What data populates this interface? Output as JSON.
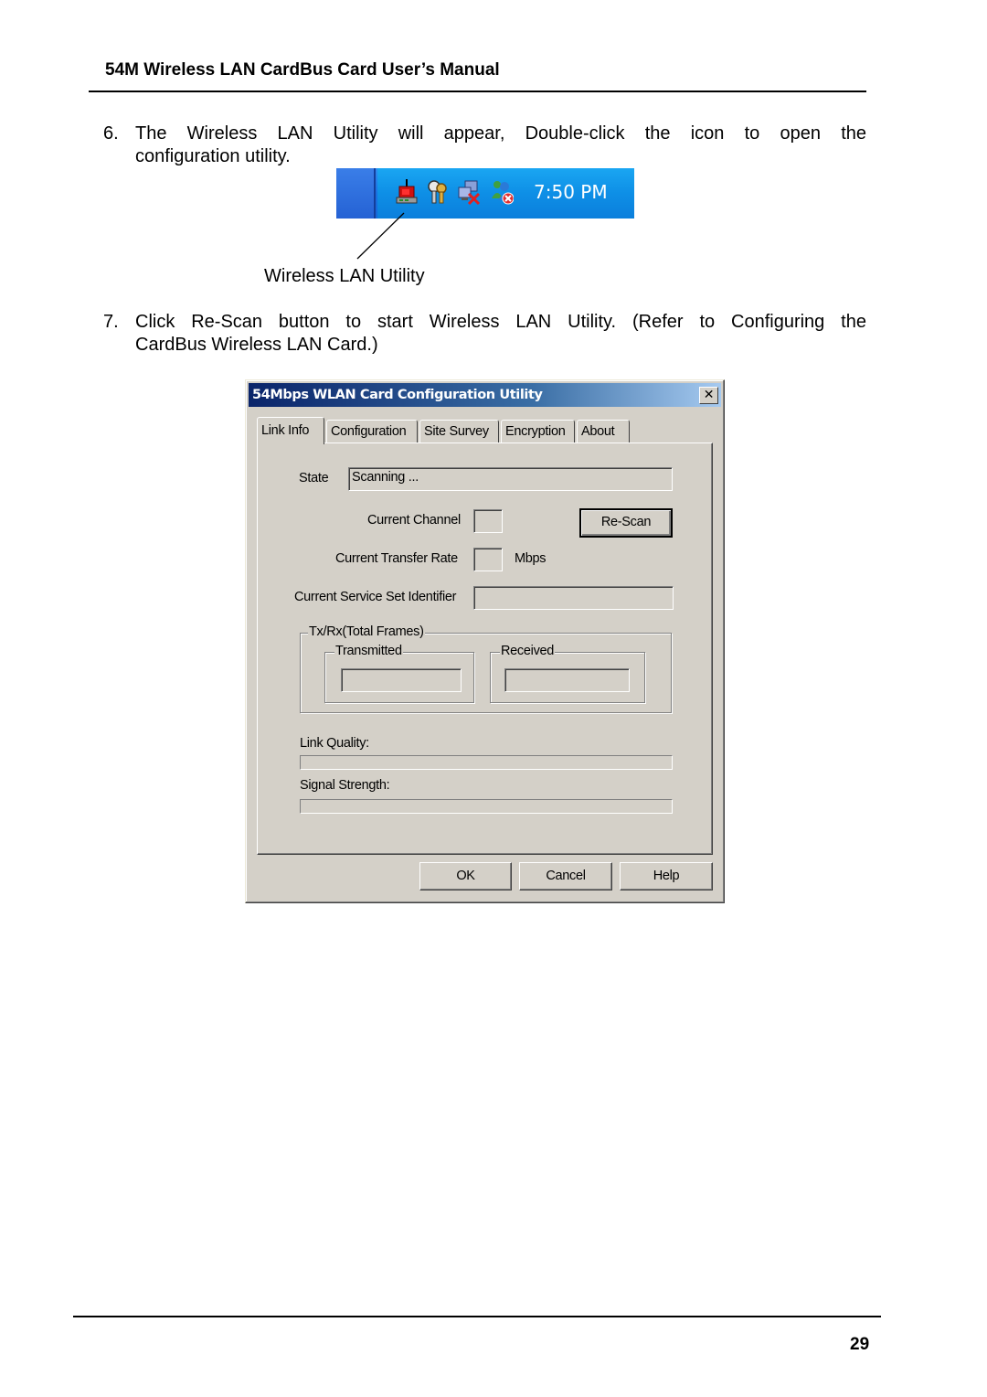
{
  "header": {
    "title": "54M Wireless LAN CardBus Card User’s Manual"
  },
  "steps": [
    {
      "number": "6.",
      "line1": "The Wireless LAN Utility will appear, Double-click the icon to open the",
      "line2": "configuration utility."
    },
    {
      "number": "7.",
      "line1": "Click Re-Scan button to start Wireless LAN Utility. (Refer to Configuring the",
      "line2": "CardBus Wireless LAN Card.)"
    }
  ],
  "tray": {
    "clock": "7:50 PM",
    "icons": [
      "wireless-lan-utility-icon",
      "keys-security-icon",
      "network-disconnected-icon",
      "messenger-offline-icon"
    ],
    "callout_label": "Wireless LAN Utility"
  },
  "dialog": {
    "title": "54Mbps WLAN Card Configuration Utility",
    "close_glyph": "✕",
    "tabs": [
      {
        "label": "Link Info",
        "active": true
      },
      {
        "label": "Configuration",
        "active": false
      },
      {
        "label": "Site Survey",
        "active": false
      },
      {
        "label": "Encryption",
        "active": false
      },
      {
        "label": "About",
        "active": false
      }
    ],
    "state_label": "State",
    "state_value": "Scanning ...",
    "current_channel_label": "Current Channel",
    "current_channel_value": "",
    "current_transfer_rate_label": "Current Transfer Rate",
    "current_transfer_rate_value": "",
    "transfer_rate_unit": "Mbps",
    "ssid_label": "Current Service Set Identifier",
    "ssid_value": "",
    "rescan_label": "Re-Scan",
    "txrx_group_label": "Tx/Rx(Total Frames)",
    "transmitted_label": "Transmitted",
    "transmitted_value": "",
    "received_label": "Received",
    "received_value": "",
    "link_quality_label": "Link Quality:",
    "link_quality_percent": 0,
    "signal_strength_label": "Signal Strength:",
    "signal_strength_percent": 0,
    "ok_label": "OK",
    "cancel_label": "Cancel",
    "help_label": "Help"
  },
  "footer": {
    "page_number": "29"
  }
}
